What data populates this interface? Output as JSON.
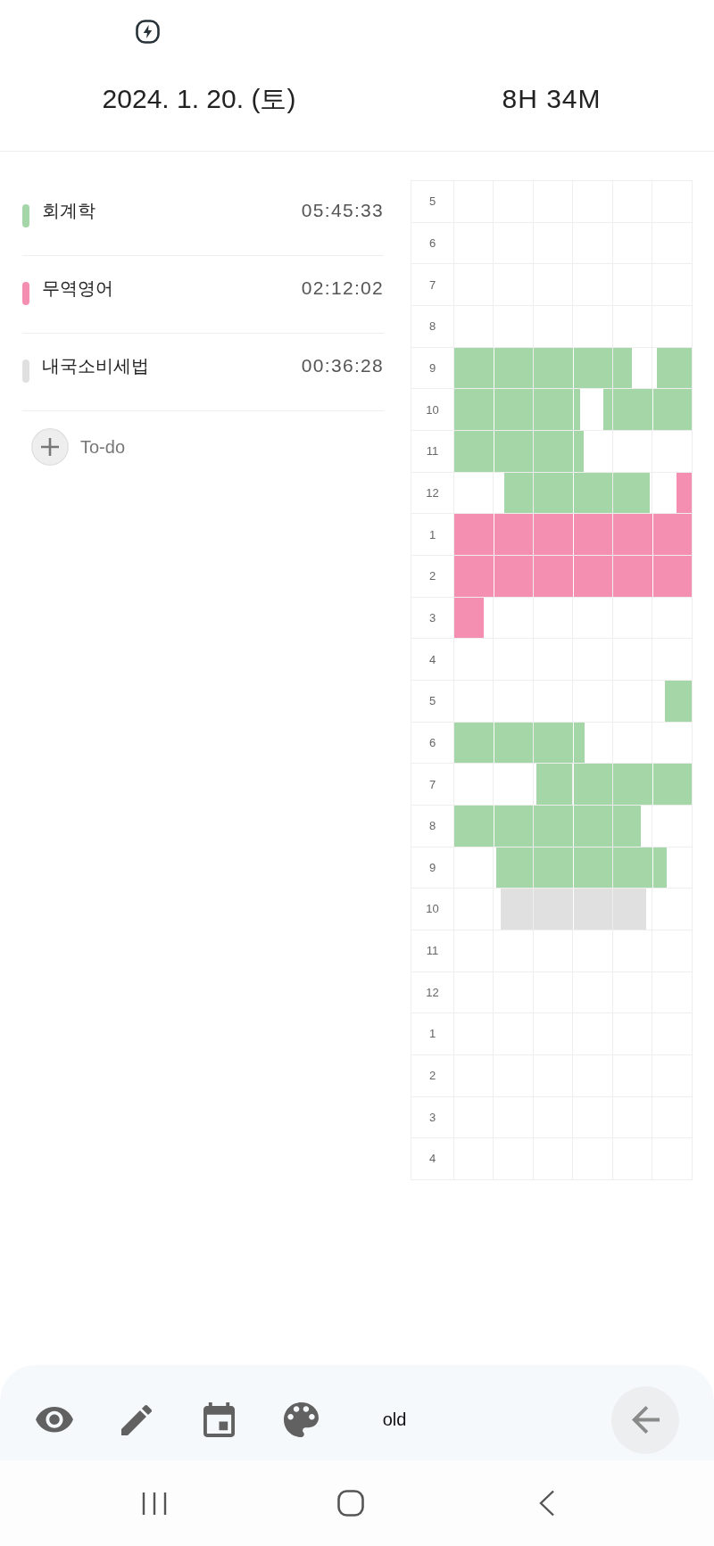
{
  "header": {
    "date": "2024. 1. 20. (토)",
    "total": "8H 34M"
  },
  "subjects": [
    {
      "name": "회계학",
      "time": "05:45:33",
      "color": "#a5d6a7"
    },
    {
      "name": "무역영어",
      "time": "02:12:02",
      "color": "#f48fb1"
    },
    {
      "name": "내국소비세법",
      "time": "00:36:28",
      "color": "#e0e0e0"
    }
  ],
  "todo": {
    "label": "To-do"
  },
  "timetable": {
    "rows": [
      {
        "label": "5"
      },
      {
        "label": "6"
      },
      {
        "label": "7"
      },
      {
        "label": "8"
      },
      {
        "label": "9"
      },
      {
        "label": "10"
      },
      {
        "label": "11"
      },
      {
        "label": "12"
      },
      {
        "label": "1"
      },
      {
        "label": "2"
      },
      {
        "label": "3"
      },
      {
        "label": "4"
      },
      {
        "label": "5"
      },
      {
        "label": "6"
      },
      {
        "label": "7"
      },
      {
        "label": "8"
      },
      {
        "label": "9"
      },
      {
        "label": "10"
      },
      {
        "label": "11"
      },
      {
        "label": "12"
      },
      {
        "label": "1"
      },
      {
        "label": "2"
      },
      {
        "label": "3"
      },
      {
        "label": "4"
      }
    ]
  },
  "toolbar": {
    "mode_label": "old"
  }
}
